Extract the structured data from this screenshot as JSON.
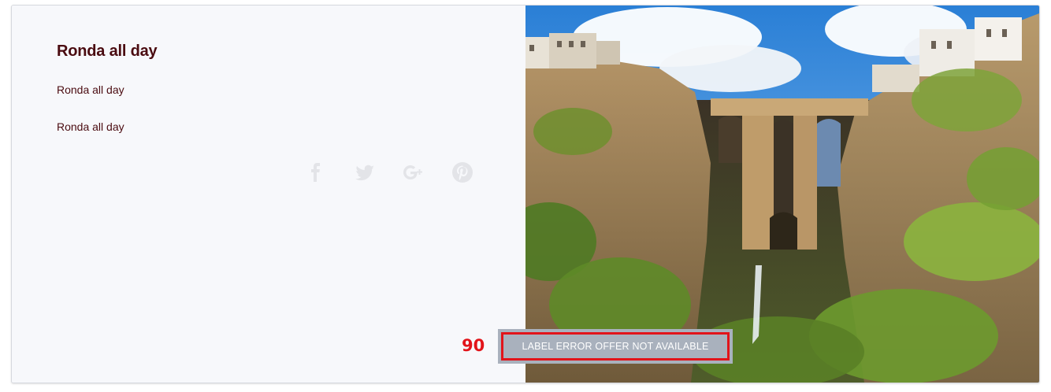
{
  "card": {
    "title": "Ronda all day",
    "line1": "Ronda all day",
    "line2": "Ronda all day"
  },
  "social": {
    "icons": [
      "facebook-icon",
      "twitter-icon",
      "google-plus-icon",
      "pinterest-icon"
    ],
    "color": "#e3e4e8"
  },
  "image": {
    "subject": "Puente Nuevo bridge over cliffs in Ronda"
  },
  "offer": {
    "price": "90",
    "label": "LABEL ERROR OFFER NOT AVAILABLE"
  },
  "colors": {
    "title": "#4a0b10",
    "price": "#e2141a",
    "badge_bg": "#a9b1bd",
    "badge_border": "#e2141a"
  }
}
